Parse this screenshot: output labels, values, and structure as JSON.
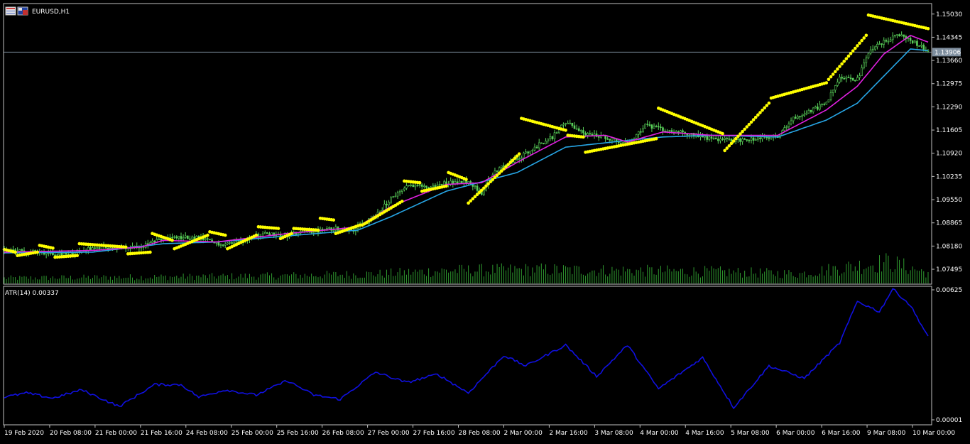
{
  "window": {
    "symbol_label": "EURUSD,H1"
  },
  "indicator": {
    "label": "ATR(14) 0.00337"
  },
  "colors": {
    "background": "#000000",
    "frame": "#c0c0c0",
    "candle": "#59d059",
    "ma_fast": "#e020e0",
    "ma_slow": "#27a6e6",
    "sar": "#ffff00",
    "volume": "#2f9a2f",
    "atr": "#1010e0",
    "price_line": "#7f8f9f",
    "price_tag_bg": "#7f8f9f"
  },
  "chart_data": [
    {
      "type": "line",
      "name": "price",
      "y_ticks": [
        "1.15030",
        "1.14345",
        "1.13660",
        "1.12975",
        "1.12290",
        "1.11605",
        "1.10920",
        "1.10235",
        "1.09550",
        "1.08865",
        "1.08180",
        "1.07495"
      ],
      "ylim": [
        1.0716,
        1.1513
      ],
      "current_price": "1.13906",
      "x_ticks": [
        "19 Feb 2020",
        "20 Feb 08:00",
        "21 Feb 00:00",
        "21 Feb 16:00",
        "24 Feb 08:00",
        "25 Feb 00:00",
        "25 Feb 16:00",
        "26 Feb 08:00",
        "27 Feb 00:00",
        "27 Feb 16:00",
        "28 Feb 08:00",
        "2 Mar 00:00",
        "2 Mar 16:00",
        "3 Mar 08:00",
        "4 Mar 00:00",
        "4 Mar 16:00",
        "5 Mar 08:00",
        "6 Mar 00:00",
        "6 Mar 16:00",
        "9 Mar 08:00",
        "10 Mar 00:00"
      ],
      "close_keypoints": [
        [
          0,
          1.0805
        ],
        [
          12,
          1.08
        ],
        [
          20,
          1.0798
        ],
        [
          30,
          1.0795
        ],
        [
          38,
          1.081
        ],
        [
          47,
          1.0815
        ],
        [
          56,
          1.081
        ],
        [
          62,
          1.0815
        ],
        [
          72,
          1.084
        ],
        [
          78,
          1.0843
        ],
        [
          88,
          1.0842
        ],
        [
          96,
          1.0825
        ],
        [
          104,
          1.0828
        ],
        [
          112,
          1.0848
        ],
        [
          120,
          1.0855
        ],
        [
          128,
          1.085
        ],
        [
          136,
          1.086
        ],
        [
          142,
          1.0863
        ],
        [
          150,
          1.087
        ],
        [
          158,
          1.0867
        ],
        [
          168,
          1.0905
        ],
        [
          175,
          1.096
        ],
        [
          184,
          1.1
        ],
        [
          192,
          1.099
        ],
        [
          200,
          1.1005
        ],
        [
          210,
          1.101
        ],
        [
          216,
          1.0975
        ],
        [
          222,
          1.104
        ],
        [
          232,
          1.1075
        ],
        [
          240,
          1.111
        ],
        [
          248,
          1.114
        ],
        [
          254,
          1.1185
        ],
        [
          262,
          1.115
        ],
        [
          272,
          1.114
        ],
        [
          282,
          1.112
        ],
        [
          290,
          1.1175
        ],
        [
          298,
          1.116
        ],
        [
          310,
          1.115
        ],
        [
          320,
          1.1135
        ],
        [
          330,
          1.113
        ],
        [
          340,
          1.1135
        ],
        [
          350,
          1.114
        ],
        [
          356,
          1.119
        ],
        [
          364,
          1.1215
        ],
        [
          372,
          1.124
        ],
        [
          378,
          1.132
        ],
        [
          386,
          1.131
        ],
        [
          392,
          1.14
        ],
        [
          398,
          1.142
        ],
        [
          404,
          1.1445
        ],
        [
          410,
          1.1425
        ],
        [
          418,
          1.1395
        ]
      ],
      "ma_fast_keypoints": [
        [
          0,
          1.08
        ],
        [
          40,
          1.0805
        ],
        [
          62,
          1.0815
        ],
        [
          72,
          1.0835
        ],
        [
          96,
          1.083
        ],
        [
          128,
          1.0855
        ],
        [
          150,
          1.0868
        ],
        [
          160,
          1.0875
        ],
        [
          175,
          1.0935
        ],
        [
          200,
          1.1
        ],
        [
          216,
          1.1005
        ],
        [
          232,
          1.1065
        ],
        [
          254,
          1.114
        ],
        [
          272,
          1.1145
        ],
        [
          282,
          1.1125
        ],
        [
          298,
          1.1155
        ],
        [
          320,
          1.1145
        ],
        [
          350,
          1.1145
        ],
        [
          372,
          1.122
        ],
        [
          386,
          1.129
        ],
        [
          398,
          1.1385
        ],
        [
          410,
          1.144
        ],
        [
          418,
          1.142
        ]
      ],
      "ma_slow_keypoints": [
        [
          0,
          1.0798
        ],
        [
          40,
          1.08
        ],
        [
          72,
          1.0825
        ],
        [
          96,
          1.083
        ],
        [
          128,
          1.0848
        ],
        [
          160,
          1.0865
        ],
        [
          175,
          1.0905
        ],
        [
          200,
          1.098
        ],
        [
          232,
          1.1035
        ],
        [
          254,
          1.111
        ],
        [
          282,
          1.113
        ],
        [
          298,
          1.114
        ],
        [
          320,
          1.1145
        ],
        [
          350,
          1.114
        ],
        [
          372,
          1.119
        ],
        [
          386,
          1.124
        ],
        [
          398,
          1.132
        ],
        [
          410,
          1.14
        ],
        [
          418,
          1.1395
        ]
      ],
      "sar_segments": [
        [
          0,
          5,
          1.0808,
          1.08
        ],
        [
          6,
          15,
          1.079,
          1.08
        ],
        [
          16,
          22,
          1.082,
          1.0812
        ],
        [
          23,
          33,
          1.0785,
          1.079
        ],
        [
          34,
          55,
          1.0825,
          1.0815
        ],
        [
          56,
          66,
          1.0795,
          1.08
        ],
        [
          67,
          76,
          1.0855,
          1.0835
        ],
        [
          77,
          92,
          1.081,
          1.085
        ],
        [
          93,
          100,
          1.086,
          1.085
        ],
        [
          101,
          114,
          1.081,
          1.085
        ],
        [
          115,
          124,
          1.0875,
          1.087
        ],
        [
          125,
          130,
          1.084,
          1.0855
        ],
        [
          131,
          142,
          1.087,
          1.0865
        ],
        [
          143,
          149,
          1.09,
          1.0895
        ],
        [
          150,
          161,
          1.0855,
          1.088
        ],
        [
          162,
          180,
          1.088,
          1.095
        ],
        [
          181,
          188,
          1.101,
          1.1005
        ],
        [
          189,
          200,
          1.098,
          1.0995
        ],
        [
          201,
          209,
          1.1035,
          1.1015
        ],
        [
          210,
          233,
          1.0945,
          1.109
        ],
        [
          234,
          254,
          1.1195,
          1.116
        ],
        [
          255,
          262,
          1.1145,
          1.114
        ],
        [
          263,
          295,
          1.1095,
          1.1135
        ],
        [
          296,
          325,
          1.1225,
          1.115
        ],
        [
          326,
          346,
          1.11,
          1.124
        ],
        [
          347,
          372,
          1.1255,
          1.13
        ],
        [
          373,
          390,
          1.131,
          1.144
        ],
        [
          391,
          418,
          1.15,
          1.146
        ]
      ]
    },
    {
      "type": "area",
      "name": "volume",
      "keypoints": [
        [
          0,
          0.25
        ],
        [
          60,
          0.3
        ],
        [
          120,
          0.35
        ],
        [
          170,
          0.45
        ],
        [
          200,
          0.6
        ],
        [
          240,
          0.65
        ],
        [
          280,
          0.6
        ],
        [
          320,
          0.55
        ],
        [
          360,
          0.45
        ],
        [
          380,
          0.75
        ],
        [
          400,
          1.0
        ],
        [
          418,
          0.5
        ]
      ]
    },
    {
      "type": "line",
      "name": "ATR(14)",
      "y_ticks": [
        "0.00625",
        "0.00001"
      ],
      "ylim": [
        1e-05,
        0.00625
      ],
      "keypoints": [
        [
          0,
          0.0011
        ],
        [
          10,
          0.0013
        ],
        [
          22,
          0.00105
        ],
        [
          35,
          0.00145
        ],
        [
          52,
          0.00065
        ],
        [
          68,
          0.0017
        ],
        [
          80,
          0.0017
        ],
        [
          88,
          0.0011
        ],
        [
          100,
          0.00145
        ],
        [
          114,
          0.0012
        ],
        [
          128,
          0.0019
        ],
        [
          140,
          0.0012
        ],
        [
          152,
          0.001
        ],
        [
          168,
          0.0023
        ],
        [
          182,
          0.0018
        ],
        [
          196,
          0.0022
        ],
        [
          210,
          0.0013
        ],
        [
          226,
          0.0031
        ],
        [
          236,
          0.0026
        ],
        [
          254,
          0.0036
        ],
        [
          268,
          0.0021
        ],
        [
          282,
          0.0036
        ],
        [
          296,
          0.0015
        ],
        [
          316,
          0.003
        ],
        [
          330,
          0.0006
        ],
        [
          346,
          0.0026
        ],
        [
          362,
          0.002
        ],
        [
          378,
          0.0037
        ],
        [
          386,
          0.0057
        ],
        [
          396,
          0.0052
        ],
        [
          402,
          0.0063
        ],
        [
          410,
          0.0055
        ],
        [
          418,
          0.004
        ]
      ]
    }
  ]
}
